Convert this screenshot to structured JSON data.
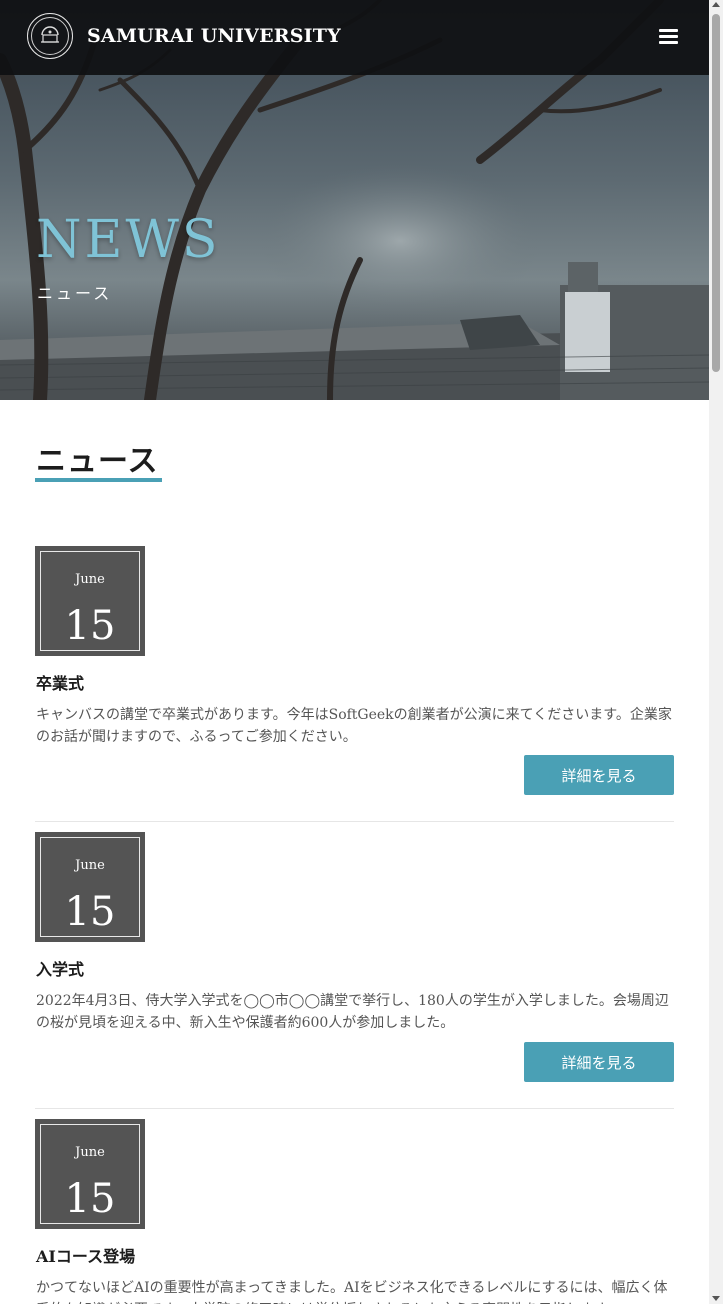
{
  "header": {
    "brand": "SAMURAI UNIVERSITY",
    "logo_icon": "university-seal-icon",
    "menu_icon": "hamburger-menu-icon"
  },
  "hero": {
    "title": "NEWS",
    "subtitle": "ニュース"
  },
  "section": {
    "title": "ニュース"
  },
  "news": [
    {
      "month": "June",
      "day": "15",
      "title": "卒業式",
      "body": "キャンバスの講堂で卒業式があります。今年はSoftGeekの創業者が公演に来てくださいます。企業家のお話が聞けますので、ふるってご参加ください。",
      "button": "詳細を見る"
    },
    {
      "month": "June",
      "day": "15",
      "title": "入学式",
      "body": "2022年4月3日、侍大学入学式を◯◯市◯◯講堂で挙行し、180人の学生が入学しました。会場周辺の桜が見頃を迎える中、新入生や保護者約600人が参加しました。",
      "button": "詳細を見る"
    },
    {
      "month": "June",
      "day": "15",
      "title": "AIコース登場",
      "body": "かつてないほどAIの重要性が高まってきました。AIをビジネス化できるレベルにするには、幅広く体系的な知識が必要です。大学院の修了時には学位授与されるとも言える専門性を目指します。"
    }
  ],
  "colors": {
    "accent": "#4aa0b5",
    "date_box": "#545454",
    "hero_title": "#7fc3d6",
    "header_bg": "#0f1012"
  }
}
